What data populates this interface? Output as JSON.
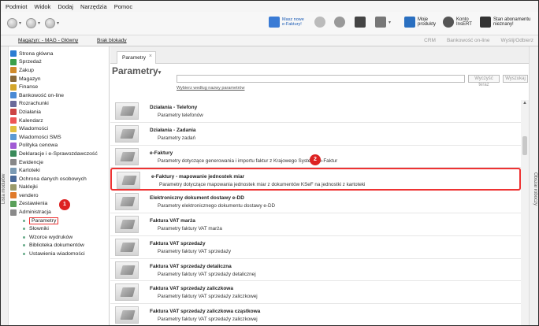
{
  "menu": [
    "Podmiot",
    "Widok",
    "Dodaj",
    "Narzędzia",
    "Pomoc"
  ],
  "toolbar": {
    "promo": "Masz nowe\ne-Faktury!",
    "products": "Moje\nprodukty",
    "account": "Konto\nInsERT",
    "subscription": "Stan abonamentu\nnieznany!"
  },
  "subbar": {
    "magazine": "Magazyn: - MAG - Główny",
    "block": "Brak blokady",
    "crm": "CRM",
    "bank": "Bankowość on-line",
    "send": "Wyślij/Odbierz"
  },
  "strips": {
    "left": "Lista modułów",
    "right": "Obszar roboczy"
  },
  "tree": [
    "Strona główna",
    "Sprzedaż",
    "Zakup",
    "Magazyn",
    "Finanse",
    "Bankowość on-line",
    "Rozrachunki",
    "Działania",
    "Kalendarz",
    "Wiadomości",
    "Wiadomości SMS",
    "Polityka cenowa",
    "Deklaracje i e-Sprawozdawczość",
    "Ewidencje",
    "Kartoteki",
    "Ochrona danych osobowych",
    "Naklejki",
    "vendero",
    "Zestawienia",
    "Administracja"
  ],
  "tree_sub": [
    "Parametry",
    "Słowniki",
    "Wzorce wydruków",
    "Biblioteka dokumentów",
    "Ustawienia wiadomości"
  ],
  "tab": "Parametry",
  "heading": "Parametry",
  "search": {
    "clear": "Wyczyść teraz",
    "go": "Wyszukaj",
    "advanced": "Wybierz według nazwy parametrów"
  },
  "rows": [
    {
      "title": "Działania - Telefony",
      "desc": "Parametry telefonów"
    },
    {
      "title": "Działania - Zadania",
      "desc": "Parametry zadań"
    },
    {
      "title": "e-Faktury",
      "desc": "Parametry dotyczące generowania i importu faktur z Krajowego Systemu e-Faktur"
    },
    {
      "title": "e-Faktury - mapowanie jednostek miar",
      "desc": "Parametry dotyczące mapowania jednostek miar z dokumentów KSeF na jednostki z kartoteki"
    },
    {
      "title": "Elektroniczny dokument dostawy e-DD",
      "desc": "Parametry elektronicznego dokumentu dostawy e-DD"
    },
    {
      "title": "Faktura VAT marża",
      "desc": "Parametry faktury VAT marża"
    },
    {
      "title": "Faktura VAT sprzedaży",
      "desc": "Parametry faktury VAT sprzedaży"
    },
    {
      "title": "Faktura VAT sprzedaży detaliczna",
      "desc": "Parametry faktury VAT sprzedaży detalicznej"
    },
    {
      "title": "Faktura VAT sprzedaży zaliczkowa",
      "desc": "Parametry faktury VAT sprzedaży zaliczkowej"
    },
    {
      "title": "Faktura VAT sprzedaży zaliczkowa cząstkowa",
      "desc": "Parametry faktury VAT sprzedaży zaliczkowej"
    }
  ],
  "badges": {
    "one": "1",
    "two": "2"
  },
  "colors": {
    "accent": "#e33333",
    "badge": "#dd2222"
  }
}
